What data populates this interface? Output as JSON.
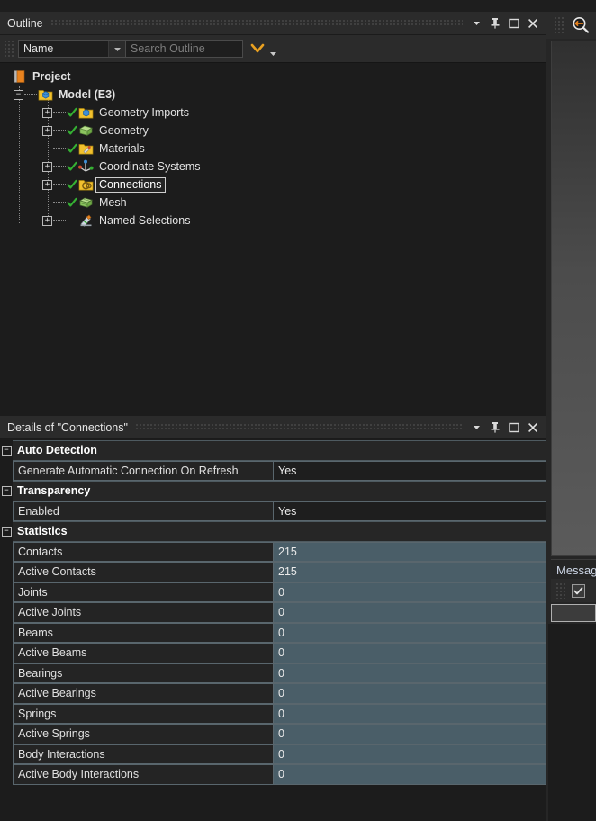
{
  "outline": {
    "title": "Outline",
    "title_icons": [
      "chevron-down-icon",
      "pin-icon",
      "maximize-icon",
      "close-icon"
    ],
    "toolbar": {
      "filter_value": "Name",
      "search_placeholder": "Search Outline",
      "expand_label": "⌄"
    },
    "tree": [
      {
        "label": "Project",
        "depth": 0,
        "bold": true,
        "expander": "",
        "check": "none",
        "icon": "project-icon",
        "selected": false
      },
      {
        "label": "Model (E3)",
        "depth": 1,
        "bold": true,
        "expander": "-",
        "check": "none",
        "icon": "model-folder-icon",
        "selected": false
      },
      {
        "label": "Geometry Imports",
        "depth": 2,
        "bold": false,
        "expander": "+",
        "check": "green",
        "icon": "geometry-imports-icon",
        "selected": false
      },
      {
        "label": "Geometry",
        "depth": 2,
        "bold": false,
        "expander": "+",
        "check": "green",
        "icon": "geometry-icon",
        "selected": false
      },
      {
        "label": "Materials",
        "depth": 2,
        "bold": false,
        "expander": "",
        "check": "green",
        "icon": "materials-icon",
        "selected": false
      },
      {
        "label": "Coordinate Systems",
        "depth": 2,
        "bold": false,
        "expander": "+",
        "check": "green",
        "icon": "coordinate-systems-icon",
        "selected": false
      },
      {
        "label": "Connections",
        "depth": 2,
        "bold": false,
        "expander": "+",
        "check": "green",
        "icon": "connections-icon",
        "selected": true
      },
      {
        "label": "Mesh",
        "depth": 2,
        "bold": false,
        "expander": "",
        "check": "green",
        "icon": "mesh-icon",
        "selected": false
      },
      {
        "label": "Named Selections",
        "depth": 2,
        "bold": false,
        "expander": "+",
        "check": "none",
        "icon": "named-selections-icon",
        "selected": false
      }
    ]
  },
  "details": {
    "title": "Details of \"Connections\"",
    "title_icons": [
      "chevron-down-icon",
      "pin-icon",
      "maximize-icon",
      "close-icon"
    ],
    "rows": [
      {
        "kind": "group",
        "label": "Auto Detection",
        "collapse": "-"
      },
      {
        "kind": "prop",
        "label": "Generate Automatic Connection On Refresh",
        "value": "Yes",
        "readonly": false
      },
      {
        "kind": "group",
        "label": "Transparency",
        "collapse": "-"
      },
      {
        "kind": "prop",
        "label": "Enabled",
        "value": "Yes",
        "readonly": false
      },
      {
        "kind": "group",
        "label": "Statistics",
        "collapse": "-"
      },
      {
        "kind": "prop",
        "label": "Contacts",
        "value": "215",
        "readonly": true
      },
      {
        "kind": "prop",
        "label": "Active Contacts",
        "value": "215",
        "readonly": true
      },
      {
        "kind": "prop",
        "label": "Joints",
        "value": "0",
        "readonly": true
      },
      {
        "kind": "prop",
        "label": "Active Joints",
        "value": "0",
        "readonly": true
      },
      {
        "kind": "prop",
        "label": "Beams",
        "value": "0",
        "readonly": true
      },
      {
        "kind": "prop",
        "label": "Active Beams",
        "value": "0",
        "readonly": true
      },
      {
        "kind": "prop",
        "label": "Bearings",
        "value": "0",
        "readonly": true
      },
      {
        "kind": "prop",
        "label": "Active Bearings",
        "value": "0",
        "readonly": true
      },
      {
        "kind": "prop",
        "label": "Springs",
        "value": "0",
        "readonly": true
      },
      {
        "kind": "prop",
        "label": "Active Springs",
        "value": "0",
        "readonly": true
      },
      {
        "kind": "prop",
        "label": "Body Interactions",
        "value": "0",
        "readonly": true
      },
      {
        "kind": "prop",
        "label": "Active Body Interactions",
        "value": "0",
        "readonly": true
      }
    ]
  },
  "right": {
    "zoom_icon": "zoom-to-fit-icon",
    "messages_title": "Messages",
    "messages_checkbox_checked": true
  },
  "colors": {
    "accent_orange": "#e8821e",
    "readonly_cell": "#4a5e68",
    "panel_bg": "#1c1c1c",
    "titlebar_bg": "#2b2b2b",
    "check_green": "#35b033"
  }
}
